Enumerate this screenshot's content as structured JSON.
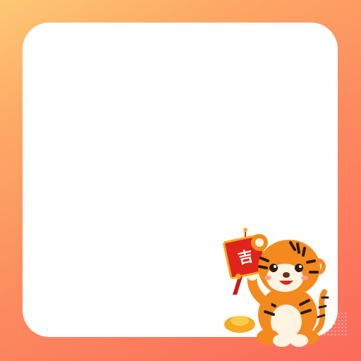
{
  "frame": {
    "gradient_colors": [
      "#FDC874",
      "#FDAA66",
      "#FC8A5F",
      "#FB6A5B"
    ],
    "panel_color": "#FFFFFF"
  },
  "sticker": {
    "icon": "tiger-mascot-icon",
    "sign_icon": "lucky-sign-icon",
    "sign_char": "吉",
    "sign_color": "#E0241B",
    "tiger_color": "#F48A1E"
  }
}
